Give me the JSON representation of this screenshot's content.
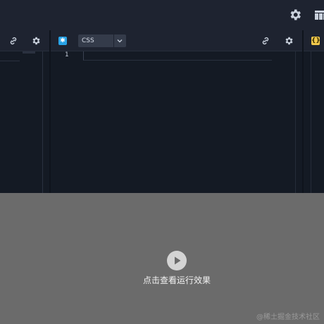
{
  "topbar": {
    "settings_icon": "gear-icon",
    "layout_icon": "layout-grid-icon"
  },
  "panes": {
    "left": {
      "link_icon": "link-icon",
      "settings_icon": "gear-icon"
    },
    "css": {
      "badge_icon": "asterisk-icon",
      "badge_color": "#29a3e6",
      "language": "CSS",
      "dropdown_icon": "chevron-down-icon",
      "link_icon": "link-icon",
      "settings_icon": "gear-icon",
      "line_numbers": [
        "1"
      ]
    },
    "js": {
      "badge_icon": "braces-icon",
      "badge_text": "{}",
      "badge_color": "#f2c94c"
    }
  },
  "preview": {
    "play_icon": "play-icon",
    "run_label": "点击查看运行效果",
    "background": "#6b6b6b"
  },
  "watermark": "@稀土掘金技术社区"
}
